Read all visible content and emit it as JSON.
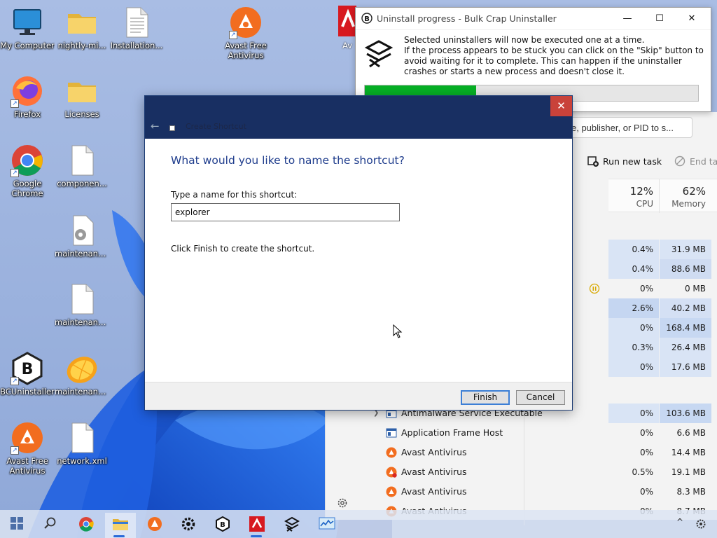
{
  "desktop": {
    "icons": [
      {
        "label": "My Computer"
      },
      {
        "label": "nightly-mi..."
      },
      {
        "label": "Installation..."
      },
      {
        "label": "Avast Free Antivirus"
      },
      {
        "label": "Firefox"
      },
      {
        "label": "Licenses"
      },
      {
        "label": "Google Chrome"
      },
      {
        "label": "componen..."
      },
      {
        "label": "maintenanc..."
      },
      {
        "label": "maintenanc..."
      },
      {
        "label": "BCUninstaller"
      },
      {
        "label": "maintenanc..."
      },
      {
        "label": "Avast Free Antivirus"
      },
      {
        "label": "network.xml"
      }
    ],
    "partial_icon_label": "Av"
  },
  "bcu_window": {
    "title": "Uninstall progress - Bulk Crap Uninstaller",
    "minimize": "—",
    "maximize": "☐",
    "close": "✕",
    "message_line1": "Selected uninstallers will now be executed one at a time.",
    "message_line2": "If the process appears to be stuck you can click on the \"Skip\" button to avoid waiting for it to complete. This can happen if the uninstaller crashes or starts a new process and doesn't close it.",
    "progress_fraction": 0.335,
    "progress_color": "#06b025"
  },
  "task_manager": {
    "search_placeholder": "e, publisher, or PID to s...",
    "run_new_task": "Run new task",
    "end_task": "End ta",
    "columns": {
      "cpu_pct": "12%",
      "cpu_label": "CPU",
      "memory_pct": "62%",
      "memory_label": "Memory"
    },
    "upper_rows": [
      {
        "cpu": "0.4%",
        "mem": "31.9 MB"
      },
      {
        "cpu": "0.4%",
        "mem": "88.6 MB"
      },
      {
        "cpu": "0%",
        "mem": "0 MB",
        "paused": true
      },
      {
        "cpu": "2.6%",
        "mem": "40.2 MB"
      },
      {
        "cpu": "0%",
        "mem": "168.4 MB"
      },
      {
        "cpu": "0.3%",
        "mem": "26.4 MB"
      },
      {
        "cpu": "0%",
        "mem": "17.6 MB"
      }
    ],
    "processes": [
      {
        "name": "Antimalware Service Executable",
        "cpu": "0%",
        "mem": "103.6 MB",
        "expandable": true
      },
      {
        "name": "Application Frame Host",
        "cpu": "0%",
        "mem": "6.6 MB"
      },
      {
        "name": "Avast Antivirus",
        "cpu": "0%",
        "mem": "14.4 MB"
      },
      {
        "name": "Avast Antivirus",
        "cpu": "0.5%",
        "mem": "19.1 MB"
      },
      {
        "name": "Avast Antivirus",
        "cpu": "0%",
        "mem": "8.3 MB"
      },
      {
        "name": "Avast Antivirus",
        "cpu": "0%",
        "mem": "8.7 MB"
      }
    ]
  },
  "shortcut_dialog": {
    "title": "Create Shortcut",
    "close": "✕",
    "back": "←",
    "heading": "What would you like to name the shortcut?",
    "field_label": "Type a name for this shortcut:",
    "field_value": "explorer",
    "hint": "Click Finish to create the shortcut.",
    "finish": "Finish",
    "cancel": "Cancel"
  },
  "taskbar": {
    "tray_chevron": "^",
    "items": [
      "start",
      "search",
      "chrome",
      "file-explorer",
      "avast",
      "settings",
      "bcuninstaller",
      "avira",
      "task-manager-cmd",
      "resource-monitor"
    ]
  }
}
